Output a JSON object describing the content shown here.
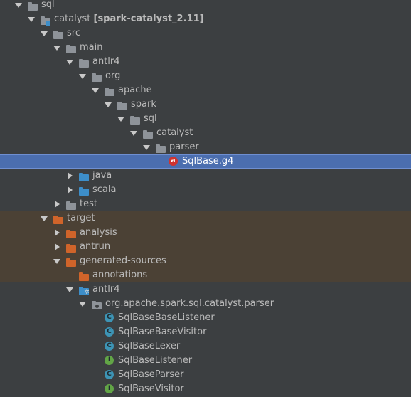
{
  "project_tree": {
    "items": [
      {
        "label": "sql"
      },
      {
        "label": "catalyst",
        "sub": "[spark-catalyst_2.11]"
      },
      {
        "label": "src"
      },
      {
        "label": "main"
      },
      {
        "label": "antlr4"
      },
      {
        "label": "org"
      },
      {
        "label": "apache"
      },
      {
        "label": "spark"
      },
      {
        "label": "sql"
      },
      {
        "label": "catalyst"
      },
      {
        "label": "parser"
      },
      {
        "label": "SqlBase.g4",
        "icon_letter": "a"
      },
      {
        "label": "java"
      },
      {
        "label": "scala"
      },
      {
        "label": "test"
      },
      {
        "label": "target"
      },
      {
        "label": "analysis"
      },
      {
        "label": "antrun"
      },
      {
        "label": "generated-sources"
      },
      {
        "label": "annotations"
      },
      {
        "label": "antlr4",
        "badge": "✲"
      },
      {
        "label": "org.apache.spark.sql.catalyst.parser"
      },
      {
        "label": "SqlBaseBaseListener",
        "icon_letter": "C"
      },
      {
        "label": "SqlBaseBaseVisitor",
        "icon_letter": "C"
      },
      {
        "label": "SqlBaseLexer",
        "icon_letter": "C"
      },
      {
        "label": "SqlBaseListener",
        "icon_letter": "I"
      },
      {
        "label": "SqlBaseParser",
        "icon_letter": "C"
      },
      {
        "label": "SqlBaseVisitor",
        "icon_letter": "I"
      }
    ]
  },
  "colors": {
    "background": "#3c3f41",
    "selection": "#4b6eaf",
    "excluded_row": "#4b4135",
    "source_folder": "#3d8ec9",
    "excluded_folder": "#d0642a"
  }
}
